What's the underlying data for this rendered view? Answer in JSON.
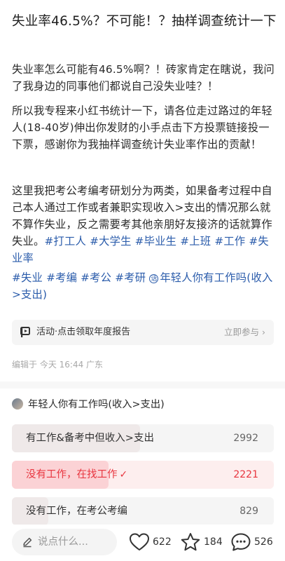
{
  "post": {
    "title": "失业率46.5%？不可能！？抽样调查统计一下",
    "para1": "失业率怎么可能有46.5%啊？！砖家肯定在瞎说，我问了我身边的同事他们都说自己没失业哇？！",
    "para2": "所以我专程来小红书统计一下，请各位走过路过的年轻人(18-40岁)伸出你发财的小手点击下方投票链接投一下票，感谢你为我抽样调查统计失业率作出的贡献！",
    "para3": "这里我把考公考编考研划分为两类，如果备考过程中自己本人通过工作或者兼职实现收入>支出的情况那么就不算作失业，反之需要考其他亲朋好友接济的话就算作失业。",
    "tags_inline": [
      "#打工人",
      "#大学生",
      "#毕业生",
      "#上班",
      "#工作",
      "#失业率"
    ],
    "tags_line2": [
      "#失业",
      "#考编",
      "#考公",
      "#考研"
    ],
    "topic_link": "年轻人你有工作吗(收入>支出)"
  },
  "activity": {
    "text": "活动·点击领取年度报告",
    "cta": "立即参与"
  },
  "meta": {
    "edited": "编辑于 今天 16:44 广东"
  },
  "poll": {
    "title": "年轻人你有工作吗(收入>支出)",
    "options": [
      {
        "label": "有工作&备考中但收入>支出",
        "count": "2992",
        "selected": false,
        "share": 0.49
      },
      {
        "label": "没有工作，在找工作",
        "count": "2221",
        "selected": true,
        "share": 0.37
      },
      {
        "label": "没有工作，在考公考编",
        "count": "829",
        "selected": false,
        "share": 0.14
      }
    ]
  },
  "bottom_bar": {
    "comment_placeholder": "说点什么...",
    "likes": "622",
    "favorites": "184",
    "comments": "526"
  },
  "colors": {
    "accent": "#e8353f",
    "tag": "#2b5cab"
  },
  "icons": {
    "activity": "activity-icon",
    "pen": "pen-icon",
    "like": "heart-icon",
    "favorite": "star-icon",
    "comment": "comment-bubble-icon",
    "check": "check-icon",
    "topic": "topic-icon"
  }
}
